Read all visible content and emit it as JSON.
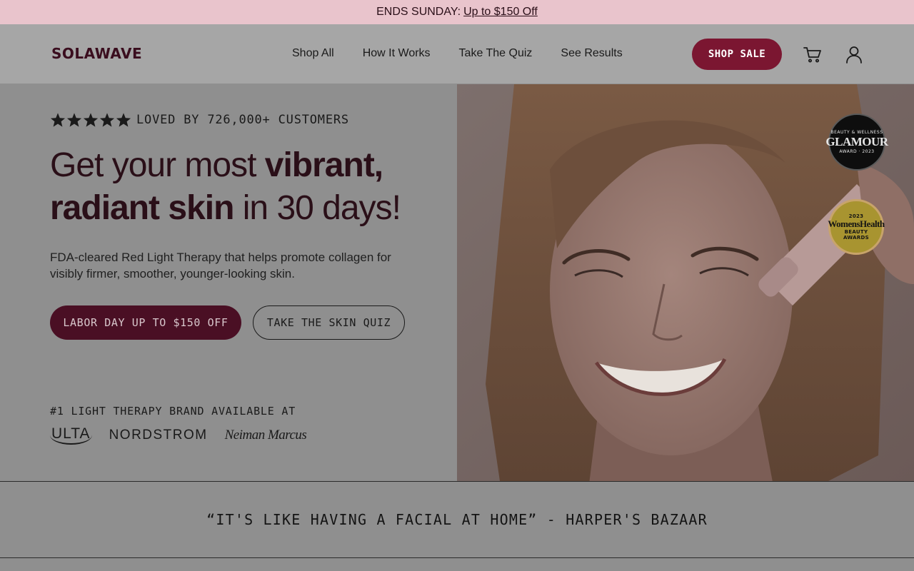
{
  "promo": {
    "prefix": "ENDS SUNDAY:",
    "link": "Up to $150 Off"
  },
  "header": {
    "logo": "SOLAWAVE",
    "nav": [
      "Shop All",
      "How It Works",
      "Take The Quiz",
      "See Results"
    ],
    "cta": "SHOP SALE",
    "icons": [
      "cart-icon",
      "account-icon"
    ]
  },
  "hero": {
    "rating_text": "LOVED BY 726,000+ CUSTOMERS",
    "rating_stars": 5,
    "headline": {
      "line1_regular": "Get your most ",
      "line1_bold": "vibrant,",
      "line2_bold": "radiant skin",
      "line2_regular": " in 30 days!"
    },
    "subtext": "FDA-cleared Red Light Therapy that helps promote collagen for visibly firmer, smoother, younger-looking skin.",
    "primary_button": "LABOR DAY UP TO $150 OFF",
    "secondary_button": "TAKE THE SKIN QUIZ",
    "retail_heading": "#1 LIGHT THERAPY BRAND AVAILABLE AT",
    "retailers": [
      "ULTA",
      "NORDSTROM",
      "Neiman Marcus"
    ],
    "badges": {
      "glamour": {
        "top": "BEAUTY & WELLNESS",
        "name": "GLAMOUR",
        "bottom": "AWARD · 2023"
      },
      "womens_health": {
        "year": "2023",
        "name": "WomensHealth",
        "line1": "BEAUTY",
        "line2": "AWARDS"
      }
    }
  },
  "quote": "“IT'S LIKE HAVING A FACIAL AT HOME” - HARPER'S BAZAAR",
  "colors": {
    "promo_bg": "#e9c4cc",
    "brand": "#3a0d1e",
    "sale_button": "#7b1631",
    "primary_button": "#4a0f24"
  }
}
